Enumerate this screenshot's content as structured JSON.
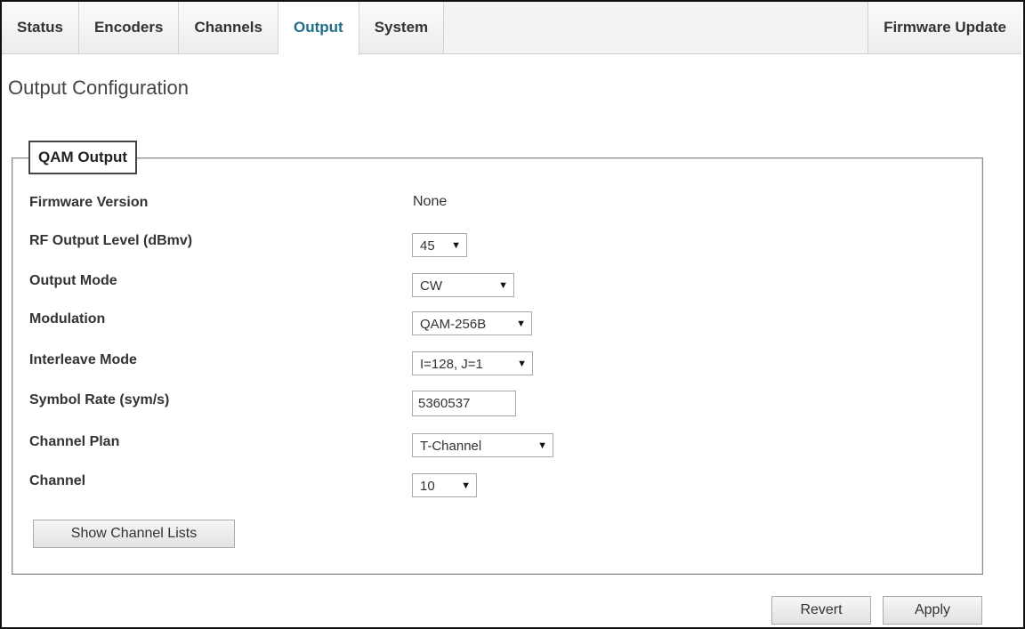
{
  "tabs": [
    {
      "label": "Status"
    },
    {
      "label": "Encoders"
    },
    {
      "label": "Channels"
    },
    {
      "label": "Output",
      "active": true
    },
    {
      "label": "System"
    }
  ],
  "tab_right": {
    "label": "Firmware Update"
  },
  "page_title": "Output Configuration",
  "qam": {
    "legend": "QAM Output",
    "firmware_version": {
      "label": "Firmware Version",
      "value": "None"
    },
    "rf_output_level": {
      "label": "RF Output Level (dBmv)",
      "value": "45"
    },
    "output_mode": {
      "label": "Output Mode",
      "value": "CW"
    },
    "modulation": {
      "label": "Modulation",
      "value": "QAM-256B"
    },
    "interleave_mode": {
      "label": "Interleave Mode",
      "value": "I=128, J=1"
    },
    "symbol_rate": {
      "label": "Symbol Rate (sym/s)",
      "value": "5360537"
    },
    "channel_plan": {
      "label": "Channel Plan",
      "value": "T-Channel"
    },
    "channel": {
      "label": "Channel",
      "value": "10"
    },
    "show_channel_lists": "Show Channel Lists"
  },
  "buttons": {
    "revert": "Revert",
    "apply": "Apply"
  },
  "icons": {
    "dropdown": "dropdown-arrow-icon",
    "glyph": "▼"
  },
  "colors": {
    "active_tab": "#1f6f8b",
    "tabbar_bg": "#f3f3f3"
  }
}
